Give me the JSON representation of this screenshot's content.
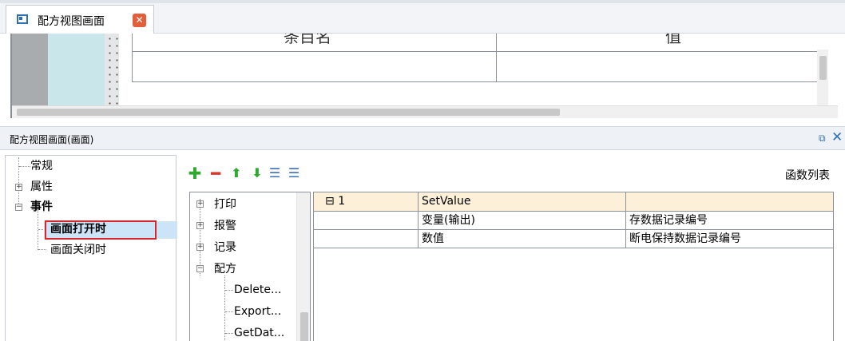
{
  "tab": {
    "label": "配方视图画面",
    "close_icon": "close-x-icon"
  },
  "preview": {
    "column_headers": [
      "条目名",
      "值"
    ]
  },
  "panel": {
    "title": "配方视图画面(画面)",
    "pin_icon": "pin-window-icon",
    "close_icon": "close-icon"
  },
  "left_tree": {
    "items": [
      {
        "label": "常规"
      },
      {
        "label": "属性",
        "expander": "+"
      },
      {
        "label": "事件",
        "expander": "−"
      },
      {
        "label": "画面打开时",
        "selected": true
      },
      {
        "label": "画面关闭时"
      }
    ]
  },
  "toolbar": {
    "buttons": [
      {
        "name": "add-icon",
        "glyph": "✚",
        "color": "#2eaa2e"
      },
      {
        "name": "remove-icon",
        "glyph": "━",
        "color": "#d9342b"
      },
      {
        "name": "move-up-icon",
        "glyph": "⬆",
        "color": "#2eaa2e"
      },
      {
        "name": "move-down-icon",
        "glyph": "⬇",
        "color": "#2eaa2e"
      },
      {
        "name": "indent-icon",
        "glyph": "☰",
        "color": "#3c6fb3"
      },
      {
        "name": "outdent-icon",
        "glyph": "☰",
        "color": "#3c6fb3"
      }
    ],
    "func_list_label": "函数列表"
  },
  "func_tree": {
    "items": [
      {
        "label": "打印",
        "expander": "+",
        "level": 0
      },
      {
        "label": "报警",
        "expander": "+",
        "level": 0
      },
      {
        "label": "记录",
        "expander": "+",
        "level": 0
      },
      {
        "label": "配方",
        "expander": "−",
        "level": 0
      },
      {
        "label": "Delete...",
        "level": 1
      },
      {
        "label": "Export...",
        "level": 1
      },
      {
        "label": "GetDat...",
        "level": 1
      }
    ]
  },
  "grid": {
    "row1": {
      "index": "1",
      "expander": "⊟",
      "function": "SetValue",
      "value": ""
    },
    "params": [
      {
        "name": "变量(输出)",
        "value": "存数据记录编号"
      },
      {
        "name": "数值",
        "value": "断电保持数据记录编号"
      }
    ]
  },
  "colors": {
    "accent": "#2f6fb5",
    "selection": "#cce4f7",
    "highlight_border": "#d7262c",
    "row_highlight": "#fdf0d8"
  }
}
